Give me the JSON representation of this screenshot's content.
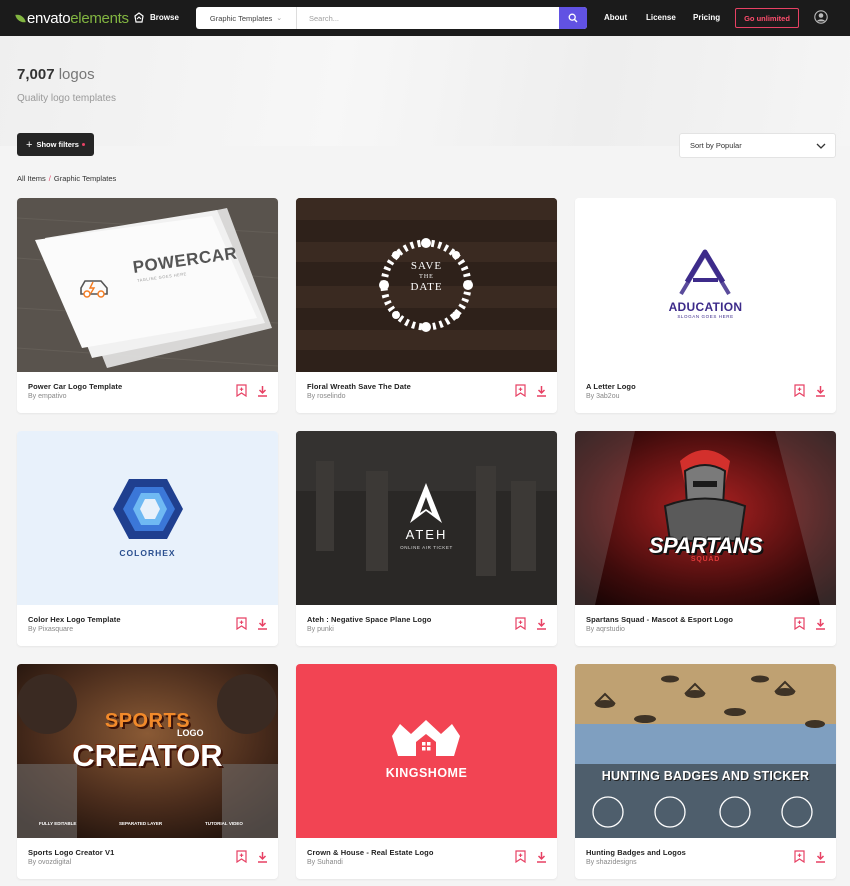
{
  "header": {
    "logo_word1": "envato",
    "logo_word2": "elements",
    "browse_label": "Browse",
    "category_label": "Graphic Templates",
    "search_placeholder": "Search...",
    "nav": [
      "About",
      "License",
      "Pricing"
    ],
    "cta_label": "Go unlimited"
  },
  "hero": {
    "count": "7,007",
    "count_unit": "logos",
    "subtitle": "Quality logo templates"
  },
  "controls": {
    "filters_label": "Show filters",
    "sort_label": "Sort by Popular"
  },
  "breadcrumb": {
    "root": "All Items",
    "separator": "/",
    "current": "Graphic Templates"
  },
  "colors": {
    "accent_pink": "#e74164",
    "search_purple": "#6152e3",
    "brand_green": "#82b541"
  },
  "cards": [
    {
      "title": "Power Car Logo Template",
      "author_prefix": "By",
      "author": "empativo",
      "art": {
        "text": "POWERCAR",
        "tagline": "TAGLINE GOES HERE"
      }
    },
    {
      "title": "Floral Wreath Save The Date",
      "author_prefix": "By",
      "author": "roselindo",
      "art": {
        "line1": "SAVE",
        "line2": "THE",
        "line3": "DATE"
      }
    },
    {
      "title": "A Letter Logo",
      "author_prefix": "By",
      "author": "3ab2ou",
      "art": {
        "text": "ADUCATION",
        "tagline": "SLOGAN GOES HERE"
      }
    },
    {
      "title": "Color Hex Logo Template",
      "author_prefix": "By",
      "author": "Pixasquare",
      "art": {
        "text": "COLORHEX"
      }
    },
    {
      "title": "Ateh : Negative Space Plane Logo",
      "author_prefix": "By",
      "author": "punki",
      "art": {
        "text": "ATEH",
        "tagline": "ONLINE AIR TICKET"
      }
    },
    {
      "title": "Spartans Squad - Mascot & Esport Logo",
      "author_prefix": "By",
      "author": "aqrstudio",
      "art": {
        "text": "SPARTANS",
        "tagline": "SQUAD"
      }
    },
    {
      "title": "Sports Logo Creator V1",
      "author_prefix": "By",
      "author": "ovozdigital",
      "art": {
        "line1": "SPORTS",
        "line2": "LOGO",
        "line3": "CREATOR",
        "f1": "FULLY EDITABLE",
        "f2": "SEPARATED LAYER",
        "f3": "TUTORIAL VIDEO"
      }
    },
    {
      "title": "Crown & House - Real Estate Logo",
      "author_prefix": "By",
      "author": "Suhandi",
      "art": {
        "text": "KINGSHOME"
      }
    },
    {
      "title": "Hunting Badges and Logos",
      "author_prefix": "By",
      "author": "shazidesigns",
      "art": {
        "text": "HUNTING BADGES AND STICKER"
      }
    }
  ]
}
